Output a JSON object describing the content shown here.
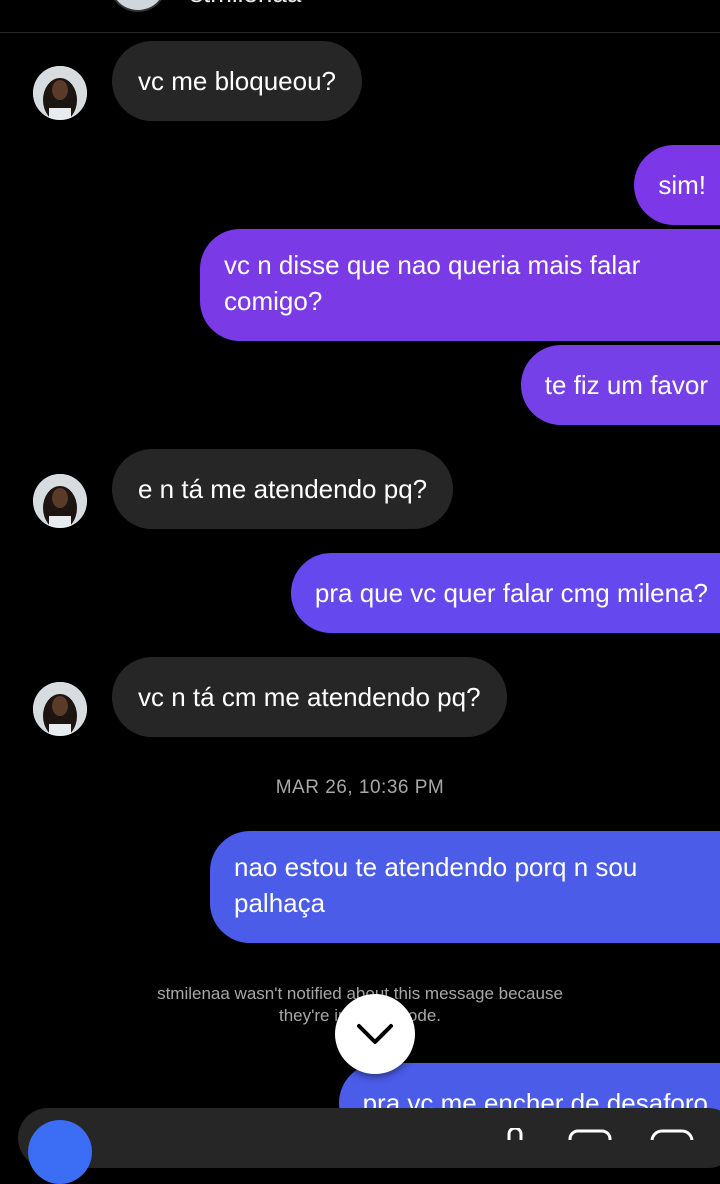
{
  "header": {
    "username": "stmilenaa"
  },
  "colors": {
    "incoming_bubble": "#262626",
    "outgoing_purple": "#7a3ae6",
    "outgoing_indigo": "#6548ee",
    "outgoing_blue": "#4a5ce8",
    "background": "#000000"
  },
  "messages": [
    {
      "side": "incoming",
      "text": "vc me bloqueou?"
    },
    {
      "side": "outgoing",
      "text": "sim!"
    },
    {
      "side": "outgoing",
      "text": "vc n disse que nao queria mais falar comigo?"
    },
    {
      "side": "outgoing",
      "text": "te fiz um favor"
    },
    {
      "side": "incoming",
      "text": "e n tá me atendendo pq?"
    },
    {
      "side": "outgoing",
      "text": "pra que vc quer falar cmg milena?"
    },
    {
      "side": "incoming",
      "text": "vc n tá cm me atendendo pq?"
    },
    {
      "side": "outgoing",
      "text": "nao estou te atendendo porq n sou palhaça"
    },
    {
      "side": "outgoing",
      "text": "pra vc me encher de desaforo"
    }
  ],
  "timestamp": "MAR 26, 10:36 PM",
  "notice_line1": "stmilenaa wasn't notified about this message because",
  "notice_line2": "they're in quiet mode.",
  "icons": {
    "scroll_down": "chevron-down-icon",
    "composer_camera": "camera-icon",
    "composer_mic": "mic-icon",
    "composer_gallery": "gallery-icon",
    "composer_sticker": "sticker-icon"
  }
}
